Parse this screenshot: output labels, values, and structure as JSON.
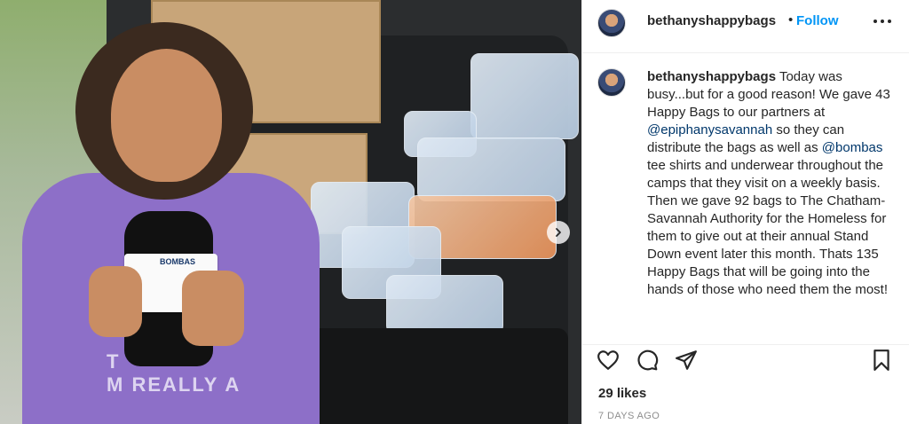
{
  "post": {
    "username": "bethanyshappybags",
    "separator": "•",
    "follow_label": "Follow",
    "caption_parts": {
      "t1": " Today was busy...but for a good reason! We gave 43 Happy Bags to our partners at ",
      "m1": "@epiphanysavannah",
      "t2": " so they can distribute the bags as well as ",
      "m2": "@bombas",
      "t3": " tee shirts and underwear throughout the camps that they visit on a weekly basis. Then we gave 92 bags to The Chatham-Savannah Authority for the Homeless for them to give out at their annual Stand Down event later this month. Thats 135 Happy Bags that will be going into the hands of those who need them the most!"
    },
    "likes": "29 likes",
    "timestamp": "7 DAYS AGO",
    "image_text": {
      "card_brand": "BOMBAS",
      "shirt_line1": "T",
      "shirt_line2": "M REALLY A"
    }
  },
  "icons": {
    "more": "more-horizontal-icon",
    "like": "heart-icon",
    "comment": "comment-icon",
    "share": "share-icon",
    "save": "bookmark-icon",
    "next": "chevron-right-icon"
  },
  "colors": {
    "follow": "#0095f6",
    "mention": "#00376b",
    "timestamp": "#8e8e8e"
  }
}
